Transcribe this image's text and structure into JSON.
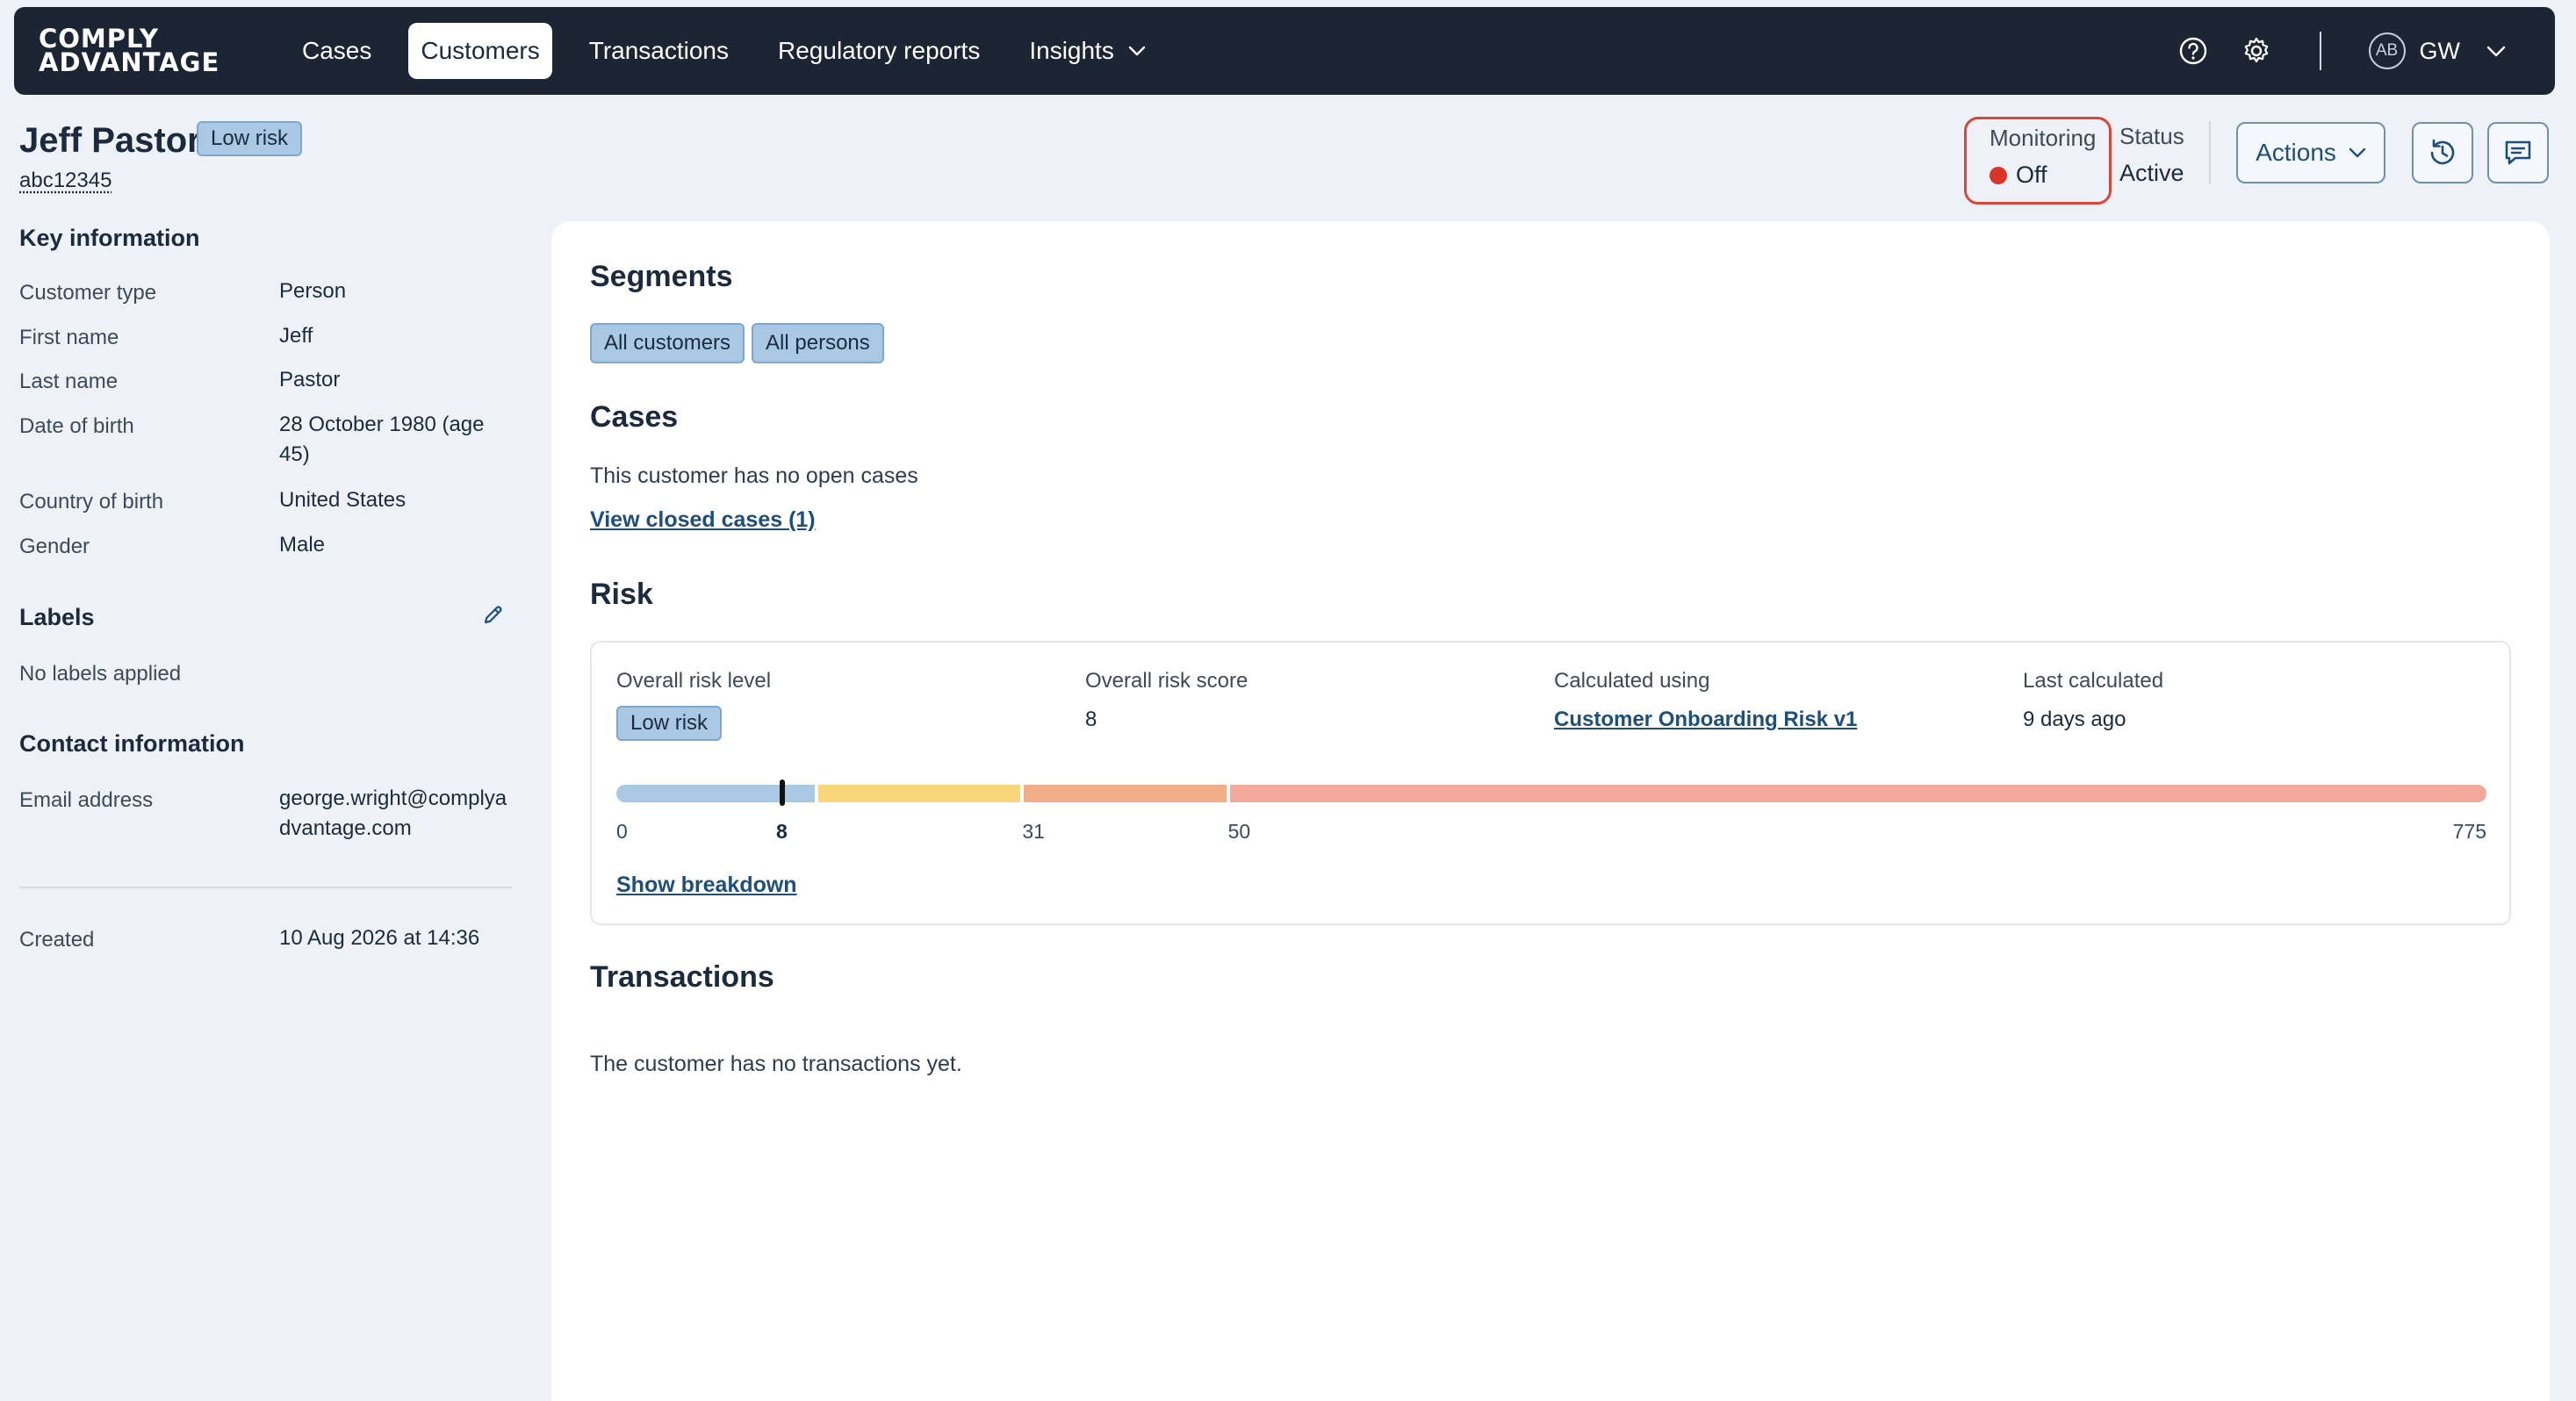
{
  "nav": {
    "logo_line1": "COMPLY",
    "logo_line2": "ADVANTAGE",
    "items": [
      {
        "label": "Cases"
      },
      {
        "label": "Customers"
      },
      {
        "label": "Transactions"
      },
      {
        "label": "Regulatory reports"
      },
      {
        "label": "Insights"
      }
    ],
    "active_item": "Customers",
    "help_icon": "help-circle-icon",
    "settings_icon": "gear-icon",
    "avatar_initials": "AB",
    "user_initials": "GW"
  },
  "header": {
    "customer_name": "Jeff Pastor",
    "risk_badge": "Low risk",
    "customer_id": "abc12345",
    "monitoring_label": "Monitoring",
    "monitoring_value": "Off",
    "status_label": "Status",
    "status_value": "Active",
    "actions_label": "Actions",
    "history_icon": "history-icon",
    "comments_icon": "comment-icon"
  },
  "key_information": {
    "title": "Key information",
    "rows": [
      {
        "label": "Customer type",
        "value": "Person"
      },
      {
        "label": "First name",
        "value": "Jeff"
      },
      {
        "label": "Last name",
        "value": "Pastor"
      },
      {
        "label": "Date of birth",
        "value": "28 October 1980 (age 45)"
      },
      {
        "label": "Country of birth",
        "value": "United States"
      },
      {
        "label": "Gender",
        "value": "Male"
      }
    ]
  },
  "labels": {
    "title": "Labels",
    "empty_text": "No labels applied",
    "edit_icon": "pencil-icon"
  },
  "contact_information": {
    "title": "Contact information",
    "email_label": "Email address",
    "email_value": "george.wright@complyadvantage.com"
  },
  "created": {
    "label": "Created",
    "value": "10 Aug 2026 at 14:36"
  },
  "segments": {
    "title": "Segments",
    "items": [
      "All customers",
      "All persons"
    ]
  },
  "cases": {
    "title": "Cases",
    "empty_text": "This customer has no open cases",
    "closed_link": "View closed cases (1)"
  },
  "risk": {
    "title": "Risk",
    "overall_level_label": "Overall risk level",
    "overall_level_value": "Low risk",
    "overall_score_label": "Overall risk score",
    "overall_score_value": "8",
    "calculated_using_label": "Calculated using",
    "calculated_using_value": "Customer Onboarding Risk v1",
    "last_calculated_label": "Last calculated",
    "last_calculated_value": "9 days ago",
    "scale": {
      "min": 0,
      "max": 775,
      "current": 8,
      "thresholds": [
        0,
        8,
        31,
        50,
        775
      ],
      "ticks": [
        "0",
        "8",
        "31",
        "50",
        "775"
      ],
      "colors": {
        "low": "#a9c8e4",
        "medium": "#f8d77a",
        "high": "#f2ae8a",
        "very_high": "#f2a89a"
      }
    },
    "breakdown_link": "Show breakdown"
  },
  "transactions": {
    "title": "Transactions",
    "empty_text": "The customer has no transactions yet."
  },
  "colors": {
    "nav_bg": "#1c2533",
    "accent": "#1d4f7c",
    "monitoring_off": "#d9352a",
    "highlight_border": "#d9453b"
  }
}
